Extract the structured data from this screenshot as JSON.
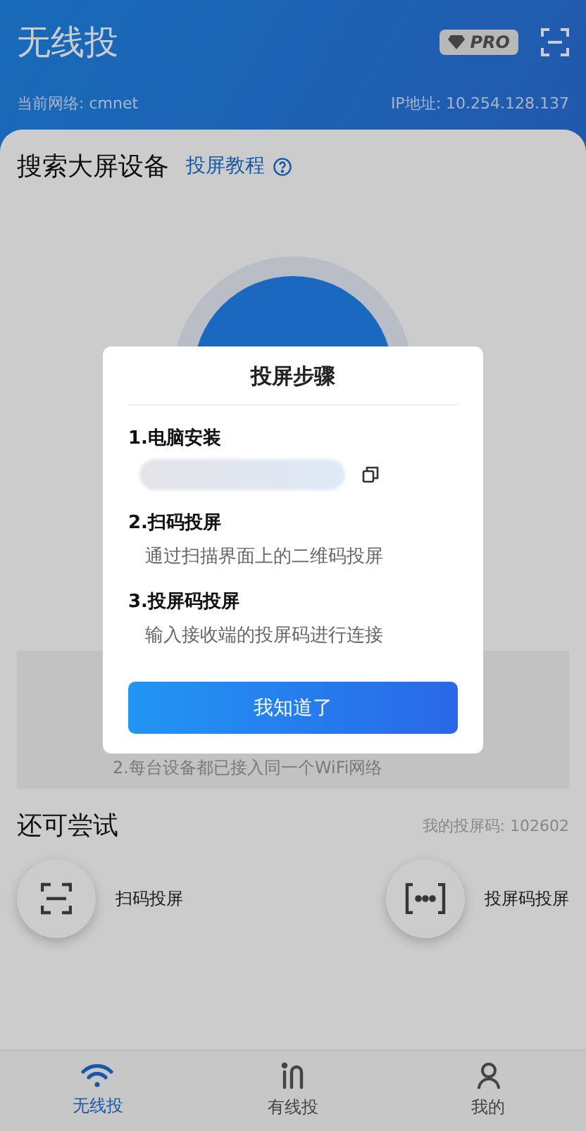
{
  "header": {
    "title": "无线投",
    "badge": "PRO",
    "network": "当前网络: cmnet",
    "ip": "IP地址: 10.254.128.137"
  },
  "search": {
    "title": "搜索大屏设备",
    "link": "投屏教程",
    "tip": "2.每台设备都已接入同一个WiFi网络"
  },
  "try": {
    "title": "还可尝试",
    "code": "我的投屏码: 102602",
    "actions": [
      {
        "kind": "scan",
        "label": "扫码投屏"
      },
      {
        "kind": "code",
        "label": "投屏码投屏"
      }
    ]
  },
  "tabs": [
    {
      "kind": "wifi",
      "label": "无线投",
      "selected": true
    },
    {
      "kind": "cable",
      "label": "有线投",
      "selected": false
    },
    {
      "kind": "person",
      "label": "我的",
      "selected": false
    }
  ],
  "dialog": {
    "title": "投屏步骤",
    "steps": [
      {
        "title": "1.电脑安装",
        "kind": "link"
      },
      {
        "title": "2.扫码投屏",
        "text": "通过扫描界面上的二维码投屏"
      },
      {
        "title": "3.投屏码投屏",
        "text": "输入接收端的投屏码进行连接"
      }
    ],
    "button": "我知道了"
  }
}
